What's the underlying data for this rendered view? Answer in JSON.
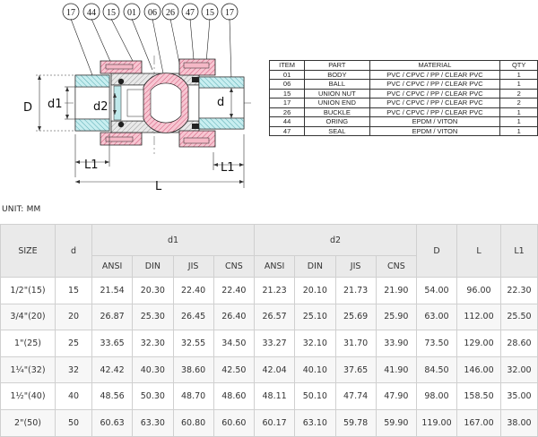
{
  "callouts": [
    "17",
    "44",
    "15",
    "01",
    "06",
    "26",
    "47",
    "15",
    "17"
  ],
  "drawing_labels": {
    "D": "D",
    "d1": "d1",
    "d2": "d2",
    "d": "d",
    "L1_left": "L1",
    "L": "L",
    "L1_right": "L1"
  },
  "parts_table": {
    "headers": [
      "ITEM",
      "PART",
      "MATERIAL",
      "QTY"
    ],
    "rows": [
      [
        "01",
        "BODY",
        "PVC / CPVC / PP / CLEAR PVC",
        "1"
      ],
      [
        "06",
        "BALL",
        "PVC / CPVC / PP / CLEAR PVC",
        "1"
      ],
      [
        "15",
        "UNION NUT",
        "PVC / CPVC / PP / CLEAR PVC",
        "2"
      ],
      [
        "17",
        "UNION END",
        "PVC / CPVC / PP / CLEAR PVC",
        "2"
      ],
      [
        "26",
        "BUCKLE",
        "PVC / CPVC / PP / CLEAR PVC",
        "1"
      ],
      [
        "44",
        "ORING",
        "EPDM / VITON",
        "1"
      ],
      [
        "47",
        "SEAL",
        "EPDM / VITON",
        "1"
      ]
    ]
  },
  "unit_label": "UNIT: MM",
  "dims_table": {
    "size_header": "SIZE",
    "d_header": "d",
    "d1_header": "d1",
    "d2_header": "d2",
    "D_header": "D",
    "L_header": "L",
    "L1_header": "L1",
    "standards": [
      "ANSI",
      "DIN",
      "JIS",
      "CNS",
      "ANSI",
      "DIN",
      "JIS",
      "CNS"
    ],
    "rows": [
      [
        "1/2\"(15)",
        "15",
        "21.54",
        "20.30",
        "22.40",
        "22.40",
        "21.23",
        "20.10",
        "21.73",
        "21.90",
        "54.00",
        "96.00",
        "22.30"
      ],
      [
        "3/4\"(20)",
        "20",
        "26.87",
        "25.30",
        "26.45",
        "26.40",
        "26.57",
        "25.10",
        "25.69",
        "25.90",
        "63.00",
        "112.00",
        "25.50"
      ],
      [
        "1\"(25)",
        "25",
        "33.65",
        "32.30",
        "32.55",
        "34.50",
        "33.27",
        "32.10",
        "31.70",
        "33.90",
        "73.50",
        "129.00",
        "28.60"
      ],
      [
        "1¼\"(32)",
        "32",
        "42.42",
        "40.30",
        "38.60",
        "42.50",
        "42.04",
        "40.10",
        "37.65",
        "41.90",
        "84.50",
        "146.00",
        "32.00"
      ],
      [
        "1½\"(40)",
        "40",
        "48.56",
        "50.30",
        "48.70",
        "48.60",
        "48.11",
        "50.10",
        "47.74",
        "47.90",
        "98.00",
        "158.50",
        "35.00"
      ],
      [
        "2\"(50)",
        "50",
        "60.63",
        "63.30",
        "60.80",
        "60.60",
        "60.17",
        "63.10",
        "59.78",
        "59.90",
        "119.00",
        "167.00",
        "38.00"
      ]
    ]
  }
}
